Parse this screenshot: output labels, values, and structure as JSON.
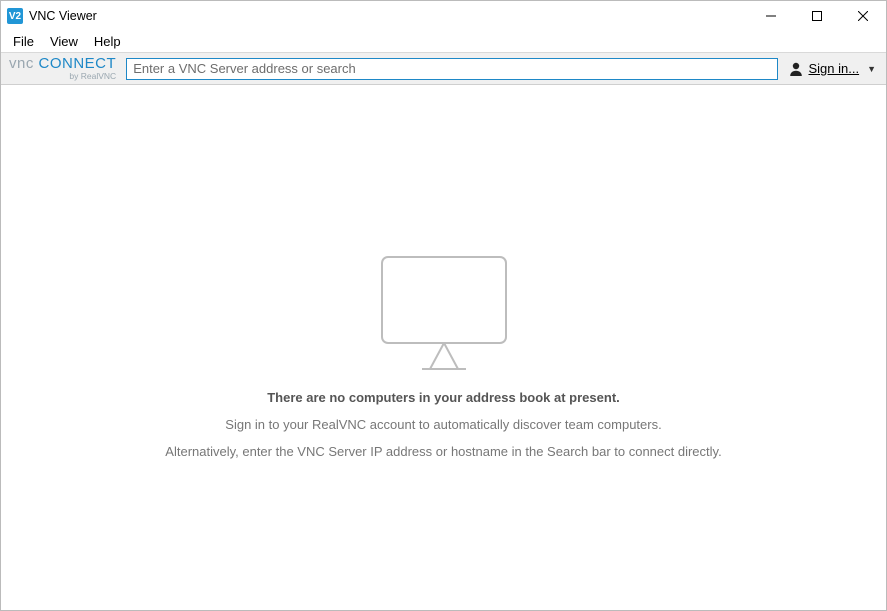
{
  "window": {
    "app_icon_text": "V2",
    "title": "VNC Viewer"
  },
  "menu": {
    "file": "File",
    "view": "View",
    "help": "Help"
  },
  "brand": {
    "part1": "vnc",
    "part2": "connect",
    "byline": "by RealVNC"
  },
  "search": {
    "placeholder": "Enter a VNC Server address or search",
    "value": ""
  },
  "signin": {
    "label": "Sign in..."
  },
  "empty": {
    "title": "There are no computers in your address book at present.",
    "line1": "Sign in to your RealVNC account to automatically discover team computers.",
    "line2": "Alternatively, enter the VNC Server IP address or hostname in the Search bar to connect directly."
  }
}
